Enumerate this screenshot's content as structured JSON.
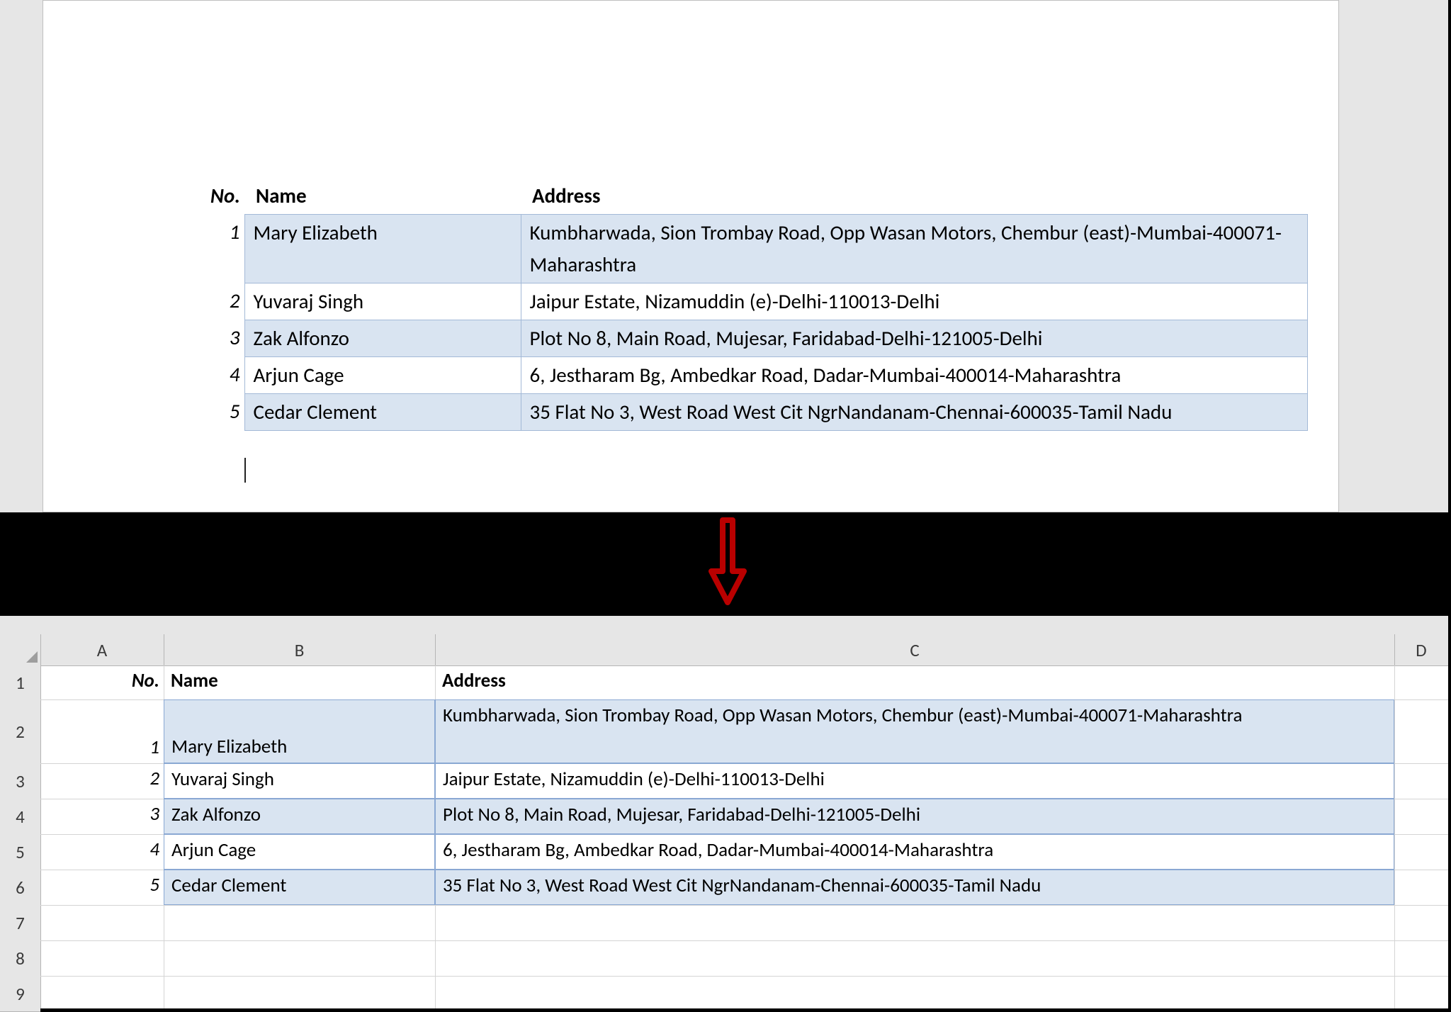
{
  "chart_data": {
    "type": "table",
    "headers": [
      "No.",
      "Name",
      "Address"
    ],
    "rows": [
      [
        1,
        "Mary Elizabeth",
        "Kumbharwada, Sion Trombay Road, Opp Wasan Motors, Chembur (east)-Mumbai-400071-Maharashtra"
      ],
      [
        2,
        "Yuvaraj Singh",
        "Jaipur Estate, Nizamuddin (e)-Delhi-110013-Delhi"
      ],
      [
        3,
        "Zak Alfonzo",
        "Plot No 8, Main Road, Mujesar, Faridabad-Delhi-121005-Delhi"
      ],
      [
        4,
        "Arjun Cage",
        "6, Jestharam Bg, Ambedkar Road, Dadar-Mumbai-400014-Maharashtra"
      ],
      [
        5,
        "Cedar Clement",
        "35 Flat No 3, West Road West Cit NgrNandanam-Chennai-600035-Tamil Nadu"
      ]
    ]
  },
  "headers": {
    "no": "No.",
    "name": "Name",
    "address": "Address"
  },
  "rows": [
    {
      "no": 1,
      "name": "Mary Elizabeth",
      "address": "Kumbharwada, Sion Trombay Road, Opp Wasan Motors, Chembur (east)-Mumbai-400071-Maharashtra"
    },
    {
      "no": 2,
      "name": "Yuvaraj Singh",
      "address": "Jaipur Estate, Nizamuddin (e)-Delhi-110013-Delhi"
    },
    {
      "no": 3,
      "name": "Zak Alfonzo",
      "address": "Plot No 8, Main Road, Mujesar, Faridabad-Delhi-121005-Delhi"
    },
    {
      "no": 4,
      "name": "Arjun Cage",
      "address": "6, Jestharam Bg, Ambedkar Road, Dadar-Mumbai-400014-Maharashtra"
    },
    {
      "no": 5,
      "name": "Cedar Clement",
      "address": "35 Flat No 3, West Road West Cit NgrNandanam-Chennai-600035-Tamil Nadu"
    }
  ],
  "excel": {
    "columns": [
      "A",
      "B",
      "C",
      "D"
    ],
    "row_numbers": [
      "1",
      "2",
      "3",
      "4",
      "5",
      "6",
      "7",
      "8",
      "9"
    ]
  }
}
